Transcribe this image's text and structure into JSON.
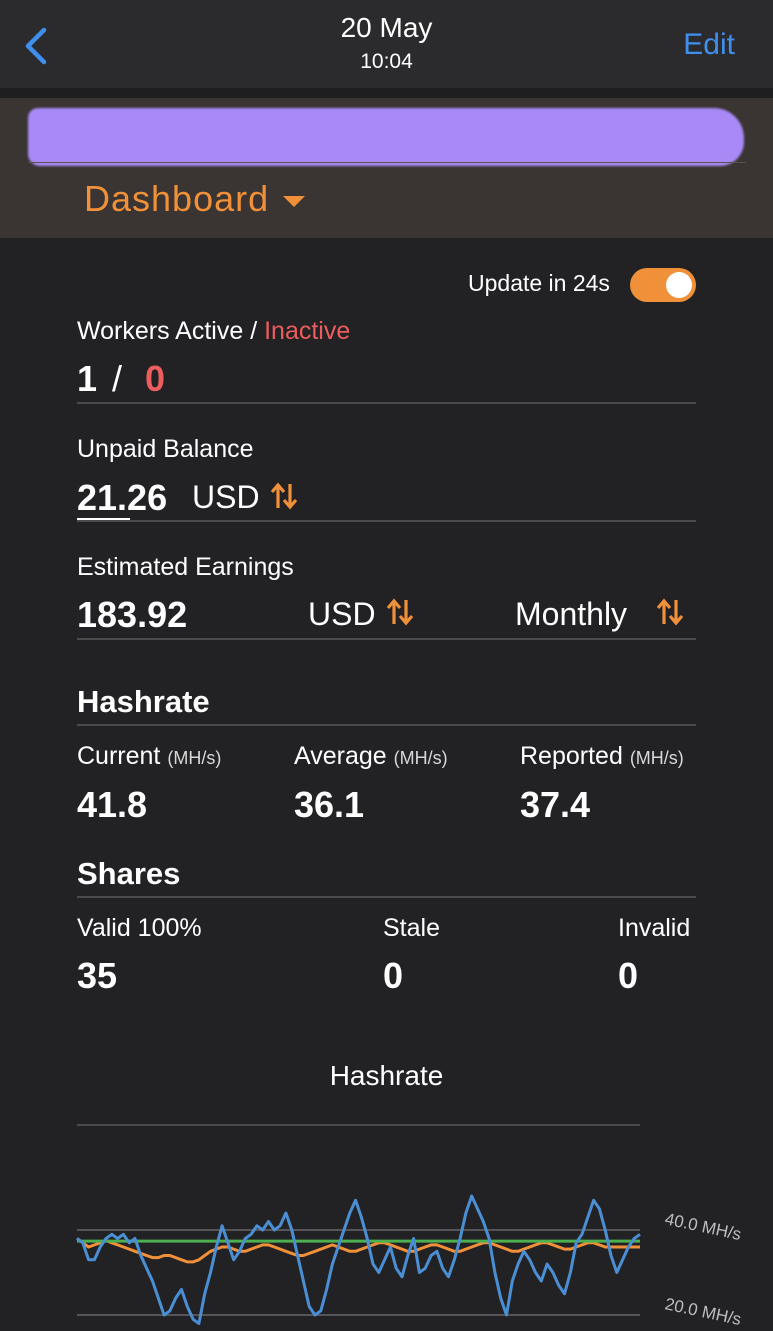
{
  "nav": {
    "date": "20 May",
    "time": "10:04",
    "edit_label": "Edit"
  },
  "header": {
    "title": "Dashboard"
  },
  "update": {
    "label": "Update in 24s",
    "toggle_on": true
  },
  "workers": {
    "label_active": "Workers Active",
    "sep": " / ",
    "label_inactive": "Inactive",
    "active": "1",
    "slash": "/",
    "inactive": "0"
  },
  "balance": {
    "label": "Unpaid Balance",
    "value": "21.26",
    "unit": "USD"
  },
  "earnings": {
    "label": "Estimated Earnings",
    "value": "183.92",
    "unit": "USD",
    "period": "Monthly"
  },
  "hashrate": {
    "title": "Hashrate",
    "unit": "(MH/s)",
    "current": {
      "label": "Current",
      "value": "41.8"
    },
    "average": {
      "label": "Average",
      "value": "36.1"
    },
    "reported": {
      "label": "Reported",
      "value": "37.4"
    }
  },
  "shares": {
    "title": "Shares",
    "valid": {
      "label": "Valid 100%",
      "value": "35"
    },
    "stale": {
      "label": "Stale",
      "value": "0"
    },
    "invalid": {
      "label": "Invalid",
      "value": "0"
    }
  },
  "colors": {
    "accent": "#f0913a",
    "inactive": "#ec5d5d",
    "link": "#3f8fef",
    "current_line": "#4a8fd4",
    "average_line": "#f0913a",
    "reported_line": "#4caf50"
  },
  "chart_data": {
    "type": "line",
    "title": "Hashrate",
    "y_ticks": [
      "40.0 MH/s",
      "20.0 MH/s"
    ],
    "ylim": [
      15,
      50
    ],
    "series": [
      {
        "values": [
          38,
          37,
          33,
          33,
          36,
          38,
          39,
          38,
          39,
          37,
          38,
          34,
          31,
          28,
          24,
          20,
          21,
          24,
          26,
          22,
          19,
          18,
          25,
          30,
          36,
          41,
          37,
          33,
          35,
          38,
          39,
          41,
          40,
          42,
          40,
          41,
          44,
          40,
          34,
          28,
          22,
          20,
          21,
          26,
          32,
          36,
          40,
          44,
          47,
          43,
          38,
          32,
          30,
          33,
          36,
          31,
          29,
          34,
          38,
          30,
          31,
          34,
          35,
          31,
          29,
          33,
          38,
          44,
          48,
          45,
          42,
          38,
          30,
          24,
          20,
          28,
          32,
          35,
          33,
          30,
          28,
          32,
          30,
          27,
          25,
          30,
          37,
          39,
          43,
          47,
          45,
          40,
          34,
          30,
          33,
          36,
          38,
          39
        ]
      },
      {
        "values": [
          38,
          37,
          36,
          36.5,
          37,
          37.5,
          37,
          36.5,
          36,
          35.5,
          35,
          34.5,
          34,
          33.5,
          33.5,
          34,
          34,
          33.5,
          33,
          32.5,
          32.5,
          33,
          34,
          35,
          35.5,
          36,
          36,
          35.5,
          35,
          35,
          35.5,
          36,
          36.5,
          36.5,
          36,
          35.5,
          35,
          34.5,
          34,
          34,
          34.5,
          35,
          35.5,
          36,
          36.5,
          36,
          35.5,
          35,
          35,
          35.5,
          36,
          36.5,
          37,
          37,
          36.5,
          36,
          35.5,
          35,
          35,
          35.5,
          36,
          36.5,
          36.5,
          36,
          35.5,
          35,
          35,
          35.5,
          36,
          36.5,
          37,
          37,
          36.5,
          36,
          35.5,
          35,
          35,
          35.5,
          36,
          36.5,
          37,
          37,
          36.5,
          36,
          35.5,
          35.5,
          36,
          36.5,
          37,
          37,
          36.5,
          36,
          36,
          36,
          36,
          36,
          36,
          36
        ]
      },
      {
        "values": [
          37.4,
          37.4,
          37.4,
          37.4,
          37.4,
          37.4,
          37.4,
          37.4,
          37.4,
          37.4,
          37.4,
          37.4,
          37.4,
          37.4,
          37.4,
          37.4,
          37.4,
          37.4,
          37.4,
          37.4,
          37.4,
          37.4,
          37.4,
          37.4,
          37.4,
          37.4,
          37.4,
          37.4,
          37.4,
          37.4,
          37.4,
          37.4,
          37.4,
          37.4,
          37.4,
          37.4,
          37.4,
          37.4,
          37.4,
          37.4,
          37.4,
          37.4,
          37.4,
          37.4,
          37.4,
          37.4,
          37.4,
          37.4,
          37.4,
          37.4,
          37.4,
          37.4,
          37.4,
          37.4,
          37.4,
          37.4,
          37.4,
          37.4,
          37.4,
          37.4,
          37.4,
          37.4,
          37.4,
          37.4,
          37.4,
          37.4,
          37.4,
          37.4,
          37.4,
          37.4,
          37.4,
          37.4,
          37.4,
          37.4,
          37.4,
          37.4,
          37.4,
          37.4,
          37.4,
          37.4,
          37.4,
          37.4,
          37.4,
          37.4,
          37.4,
          37.4,
          37.4,
          37.4,
          37.4,
          37.4,
          37.4,
          37.4,
          37.4,
          37.4,
          37.4,
          37.4,
          37.4,
          37.4
        ]
      }
    ]
  }
}
